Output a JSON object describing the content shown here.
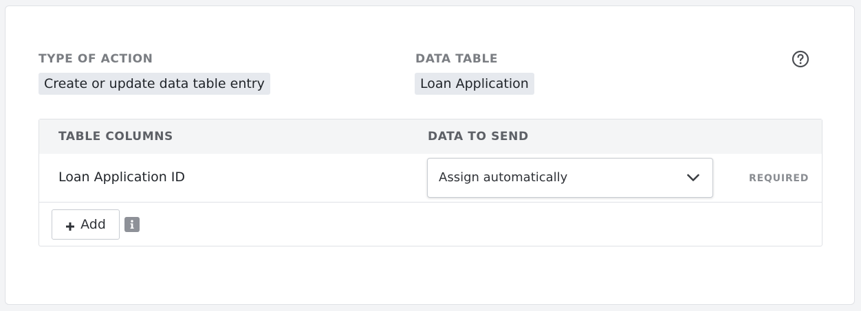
{
  "action": {
    "type_label": "TYPE OF ACTION",
    "type_value": "Create or update data table entry",
    "table_label": "DATA TABLE",
    "table_value": "Loan Application"
  },
  "help": {
    "icon": "question-circle-icon"
  },
  "mapping_table": {
    "headers": {
      "columns": "TABLE COLUMNS",
      "data": "DATA TO SEND"
    },
    "rows": [
      {
        "column": "Loan Application ID",
        "value": "Assign automatically",
        "status": "REQUIRED"
      }
    ],
    "add_label": "Add",
    "icons": {
      "add": "plus-icon",
      "info": "info-icon",
      "dropdown": "chevron-down-icon"
    }
  },
  "colors": {
    "chip_bg": "#e6e9ee",
    "header_bg": "#f4f5f6",
    "muted_text": "#7a7d82",
    "border": "#dfe1e5"
  }
}
